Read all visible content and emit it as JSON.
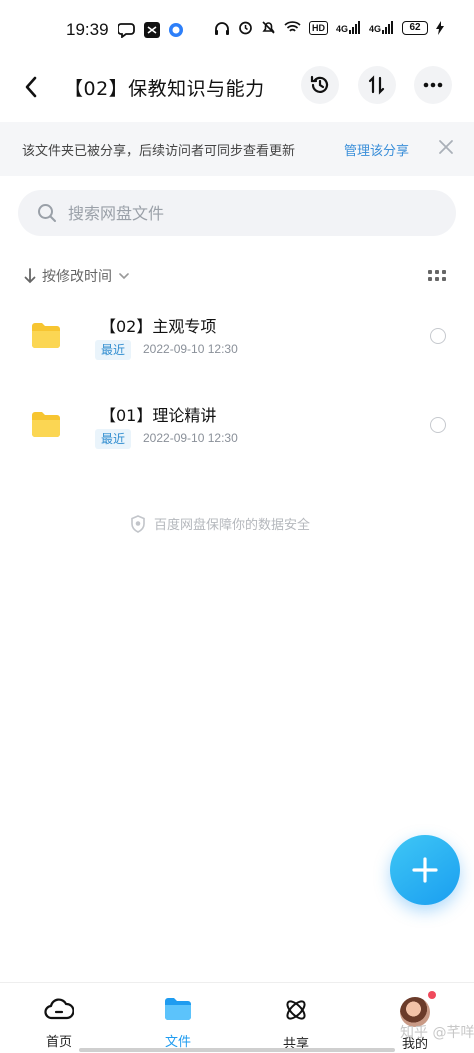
{
  "status_bar": {
    "time": "19:39",
    "battery": "62",
    "hd_label": "HD",
    "signal_1": "4G",
    "signal_2": "4G",
    "icons": [
      "chat-icon",
      "capcut-icon",
      "browser-icon",
      "headphones-icon",
      "alarm-icon",
      "mute-icon",
      "wifi-icon",
      "signal-icon",
      "charging-icon"
    ]
  },
  "header": {
    "title": "【02】保教知识与能力",
    "icons": [
      "back-arrow-icon",
      "history-icon",
      "sort-icon",
      "more-icon"
    ]
  },
  "share_banner": {
    "text": "该文件夹已被分享，后续访问者可同步查看更新",
    "link": "管理该分享"
  },
  "search": {
    "placeholder": "搜索网盘文件"
  },
  "sort": {
    "label": "按修改时间"
  },
  "files": [
    {
      "name": "【02】主观专项",
      "badge": "最近",
      "date": "2022-09-10  12:30"
    },
    {
      "name": "【01】理论精讲",
      "badge": "最近",
      "date": "2022-09-10  12:30"
    }
  ],
  "footer_note": "百度网盘保障你的数据安全",
  "bottom_nav": {
    "items": [
      {
        "label": "首页"
      },
      {
        "label": "文件"
      },
      {
        "label": "共享"
      },
      {
        "label": "我的"
      }
    ]
  },
  "watermark": "知乎 @芊咩咩",
  "colors": {
    "accent": "#1f9cf0",
    "folder": "#f8d044",
    "badge_bg": "#eaf4fb",
    "badge_text": "#2f8ccf"
  }
}
